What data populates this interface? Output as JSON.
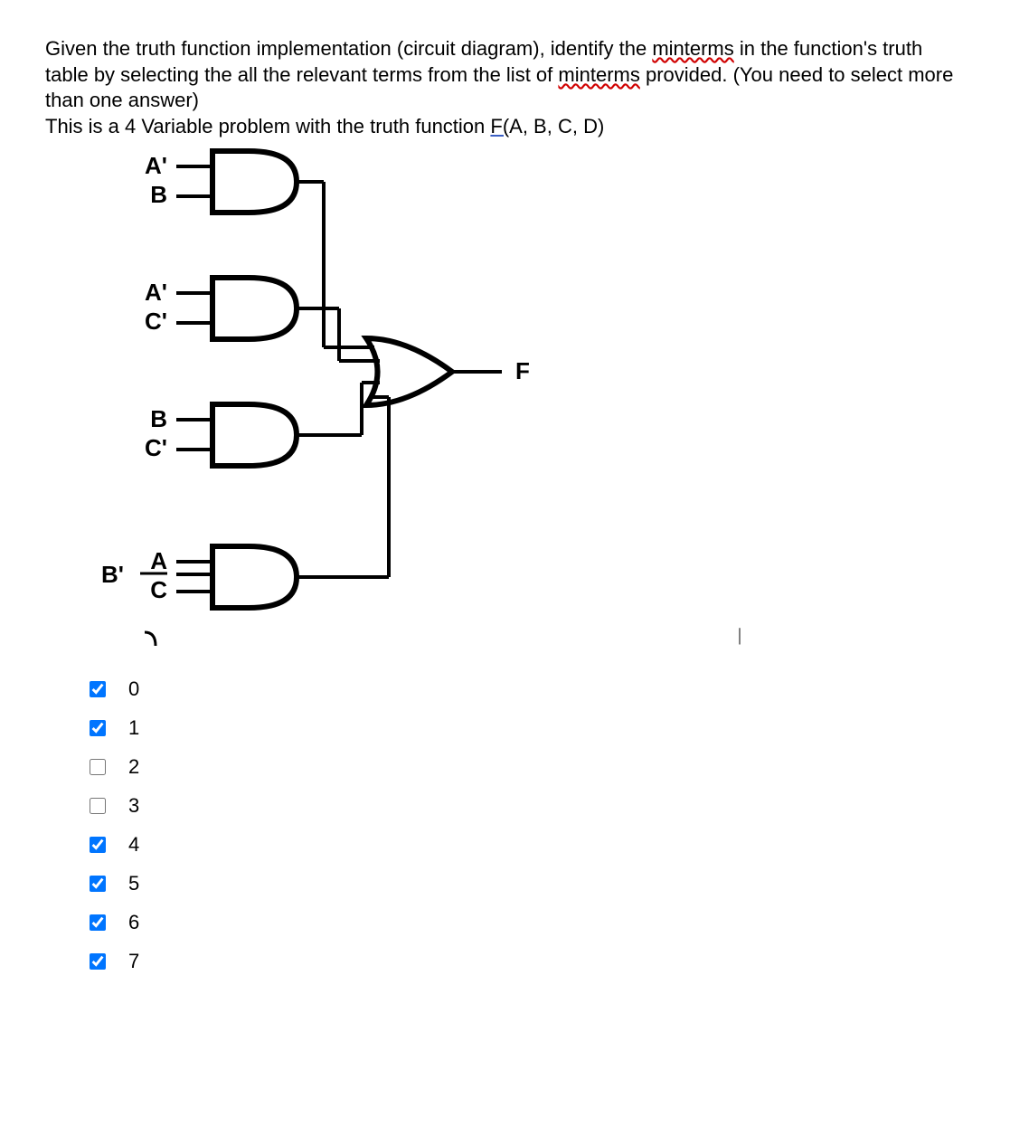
{
  "question": {
    "line1_before": "Given the truth function implementation (circuit diagram), identify the ",
    "sq1": "minterms",
    "line1_after": " in the function's truth table by selecting the all the relevant terms from the list of ",
    "sq2": "minterms",
    "line1_end": " provided. (You need to select more than one answer)",
    "line2_before": "This is a 4 Variable problem with the truth function ",
    "link": "F(",
    "line2_after": "A, B, C, D)"
  },
  "circuit": {
    "gates": [
      {
        "inputs": [
          "A'",
          "B"
        ]
      },
      {
        "inputs": [
          "A'",
          "C'"
        ]
      },
      {
        "inputs": [
          "B",
          "C'"
        ]
      },
      {
        "inputs": [
          "A",
          "C"
        ],
        "extra_left": "B'"
      }
    ],
    "output": "F"
  },
  "answers": [
    {
      "label": "0",
      "checked": true
    },
    {
      "label": "1",
      "checked": true
    },
    {
      "label": "2",
      "checked": false
    },
    {
      "label": "3",
      "checked": false
    },
    {
      "label": "4",
      "checked": true
    },
    {
      "label": "5",
      "checked": true
    },
    {
      "label": "6",
      "checked": true
    },
    {
      "label": "7",
      "checked": true
    }
  ],
  "cursor": "|"
}
